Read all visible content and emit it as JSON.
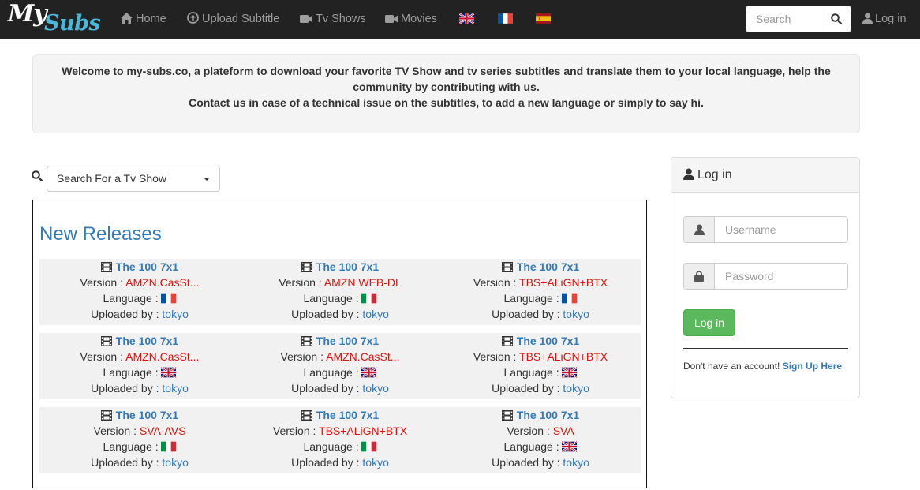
{
  "brand": {
    "logo_top": "My",
    "logo_bottom": "Subs",
    "logo_color": "#4ab8d8"
  },
  "nav": {
    "home": "Home",
    "upload": "Upload Subtitle",
    "tvshows": "Tv Shows",
    "movies": "Movies",
    "flags": [
      "english-flag-icon",
      "french-flag-icon",
      "spanish-flag-icon"
    ],
    "search_placeholder": "Search",
    "login": "Log in"
  },
  "welcome": {
    "line1": "Welcome to my-subs.co, a plateform to download your favorite TV Show and tv series subtitles and translate them to your local language, help the community by contributing with us.",
    "line2": "Contact us in case of a technical issue on the subtitles, to add a new language or simply to say hi."
  },
  "show_search": {
    "label": "Search For a Tv Show"
  },
  "releases": {
    "heading": "New Releases",
    "labels": {
      "version": "Version : ",
      "language": "Language : ",
      "uploaded": "Uploaded by : "
    },
    "items": [
      {
        "title": "The 100 7x1",
        "version": "AMZN.CasSt...",
        "language": "french",
        "uploader": "tokyo"
      },
      {
        "title": "The 100 7x1",
        "version": "AMZN.WEB-DL",
        "language": "italian",
        "uploader": "tokyo"
      },
      {
        "title": "The 100 7x1",
        "version": "TBS+ALiGN+BTX",
        "language": "french",
        "uploader": "tokyo"
      },
      {
        "title": "The 100 7x1",
        "version": "AMZN.CasSt...",
        "language": "english",
        "uploader": "tokyo"
      },
      {
        "title": "The 100 7x1",
        "version": "AMZN.CasSt...",
        "language": "english",
        "uploader": "tokyo"
      },
      {
        "title": "The 100 7x1",
        "version": "TBS+ALiGN+BTX",
        "language": "english",
        "uploader": "tokyo"
      },
      {
        "title": "The 100 7x1",
        "version": "SVA-AVS",
        "language": "italian",
        "uploader": "tokyo"
      },
      {
        "title": "The 100 7x1",
        "version": "TBS+ALiGN+BTX",
        "language": "italian",
        "uploader": "tokyo"
      },
      {
        "title": "The 100 7x1",
        "version": "SVA",
        "language": "english",
        "uploader": "tokyo"
      }
    ]
  },
  "login_panel": {
    "title": "Log in",
    "username_placeholder": "Username",
    "password_placeholder": "Password",
    "button": "Log in",
    "no_account": "Don't have an account!",
    "signup": "Sign Up Here"
  },
  "colors": {
    "navbar": "#222222",
    "link": "#337ab7",
    "version_red": "#d9140f",
    "success": "#5cb85c"
  }
}
